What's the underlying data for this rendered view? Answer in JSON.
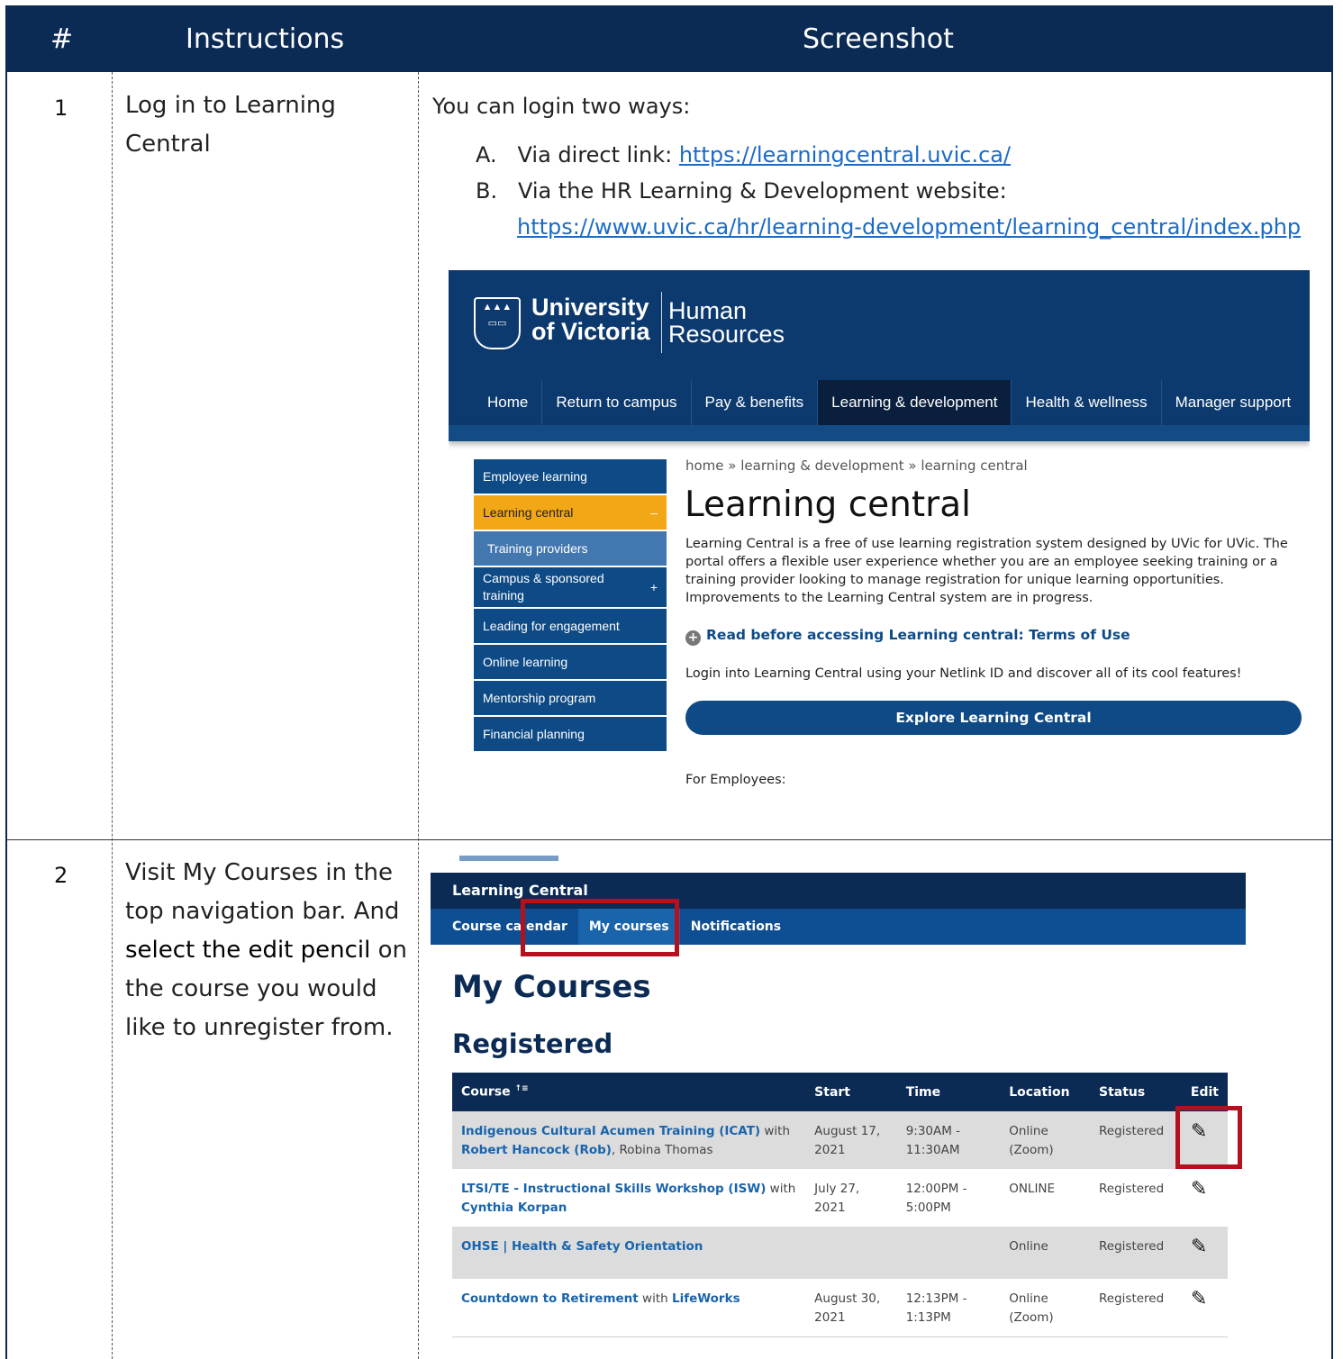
{
  "header": {
    "num": "#",
    "instructions": "Instructions",
    "screenshot": "Screenshot"
  },
  "step1": {
    "num": "1",
    "instruction": "Log in to Learning Central",
    "intro": "You can login two ways:",
    "way_a_label": "A.",
    "way_a_text": "Via direct link: ",
    "way_a_link": "https://learningcentral.uvic.ca/",
    "way_b_label": "B.",
    "way_b_text": "Via the HR Learning & Development website:",
    "way_b_link": "https://www.uvic.ca/hr/learning-development/learning_central/index.php",
    "site": {
      "university_line1": "University",
      "university_line2": "of Victoria",
      "dept_line1": "Human",
      "dept_line2": "Resources",
      "nav": [
        "Home",
        "Return to campus",
        "Pay & benefits",
        "Learning & development",
        "Health & wellness",
        "Manager support"
      ],
      "nav_active": "Learning & development",
      "side": [
        {
          "label": "Employee learning",
          "mark": ""
        },
        {
          "label": "Learning central",
          "mark": "–"
        },
        {
          "label": "Training providers",
          "mark": ""
        },
        {
          "label": "Campus & sponsored training",
          "mark": "+"
        },
        {
          "label": "Leading for engagement",
          "mark": ""
        },
        {
          "label": "Online learning",
          "mark": ""
        },
        {
          "label": "Mentorship program",
          "mark": ""
        },
        {
          "label": "Financial planning",
          "mark": ""
        }
      ],
      "breadcrumb": "home » learning & development » learning central",
      "title": "Learning central",
      "paragraph": "Learning Central is a free of use learning registration system designed by UVic for UVic. The portal offers a flexible user experience whether you are an employee seeking training or a training provider looking to manage registration for unique learning opportunities. Improvements to the Learning Central system are in progress.",
      "terms": "Read before accessing Learning central: Terms of Use",
      "login_text": "Login into Learning Central using your Netlink ID and discover all of its cool features!",
      "explore_button": "Explore Learning Central",
      "for_employees": "For Employees:"
    }
  },
  "step2": {
    "num": "2",
    "instruction_part1": "Visit My Courses in the top navigation bar. And ",
    "instruction_bold": "select the edit pencil",
    "instruction_part2": " on the course you would like to unregister from.",
    "app": {
      "brand": "Learning Central",
      "nav": [
        "Course calendar",
        "My courses",
        "Notifications"
      ],
      "nav_active": "My courses",
      "page_title": "My Courses",
      "section": "Registered",
      "columns": [
        "Course",
        "Start",
        "Time",
        "Location",
        "Status",
        "Edit"
      ],
      "sort_indicator": "↑≡",
      "rows": [
        {
          "course_link": "Indigenous Cultural Acumen Training (ICAT)",
          "with": " with ",
          "people_links": "Robert Hancock (Rob)",
          "people_rest": ", Robina Thomas",
          "start": "August 17, 2021",
          "time": "9:30AM - 11:30AM",
          "location": "Online (Zoom)",
          "status": "Registered"
        },
        {
          "course_link": "LTSI/TE - Instructional Skills Workshop (ISW)",
          "with": " with ",
          "people_links": "Cynthia Korpan",
          "people_rest": "",
          "start": "July 27, 2021",
          "time": "12:00PM - 5:00PM",
          "location": "ONLINE",
          "status": "Registered"
        },
        {
          "course_link": "OHSE | Health & Safety Orientation",
          "with": "",
          "people_links": "",
          "people_rest": "",
          "start": "",
          "time": "",
          "location": "Online",
          "status": "Registered"
        },
        {
          "course_link": "Countdown to Retirement",
          "with": " with ",
          "people_links": "LifeWorks",
          "people_rest": "",
          "start": "August 30, 2021",
          "time": "12:13PM - 1:13PM",
          "location": "Online (Zoom)",
          "status": "Registered"
        }
      ]
    }
  }
}
